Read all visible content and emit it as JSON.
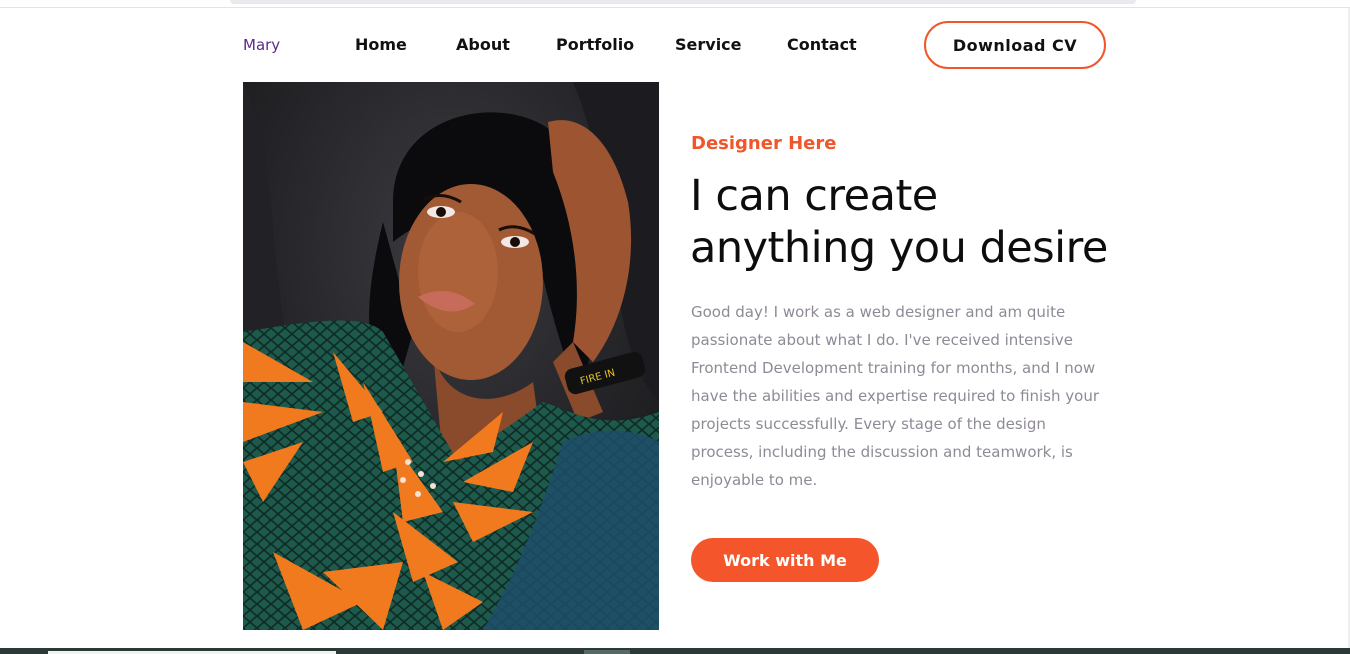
{
  "nav": {
    "logo": "Mary",
    "links": [
      "Home",
      "About",
      "Portfolio",
      "Service",
      "Contact"
    ],
    "cv_button": "Download CV"
  },
  "hero": {
    "eyebrow": "Designer Here",
    "headline_line1": "I can create",
    "headline_line2": "anything you desire",
    "description": "Good day! I work as a web designer and am quite passionate about what I do. I've received intensive Frontend Development training for months, and I now have the abilities and expertise required to finish your projects successfully. Every stage of the design process, including the discussion and teamwork, is enjoyable to me.",
    "cta": "Work with Me"
  },
  "colors": {
    "accent": "#f4552a",
    "logo": "#5d2a86",
    "body_text": "#8f8a96"
  }
}
